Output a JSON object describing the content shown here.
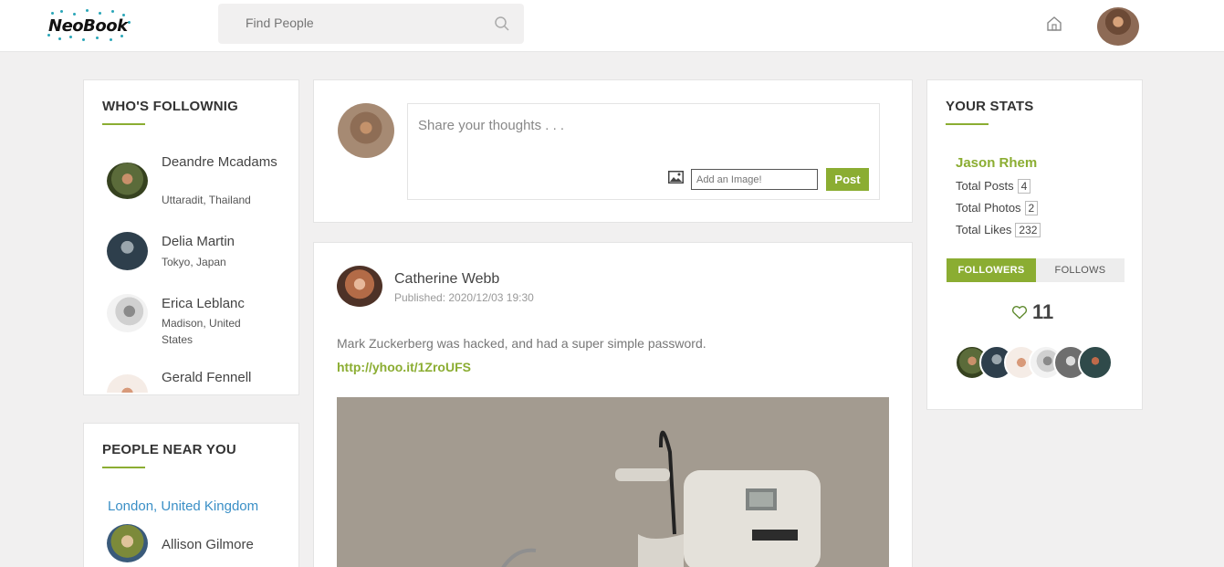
{
  "header": {
    "logo_text": "NeoBook",
    "search_placeholder": "Find People",
    "search_icon": "search-icon",
    "home_icon": "home-icon"
  },
  "following": {
    "title": "WHO'S FOLLOWNIG",
    "items": [
      {
        "name": "Deandre Mcadams",
        "location": "Uttaradit, Thailand"
      },
      {
        "name": "Delia Martin",
        "location": "Tokyo, Japan"
      },
      {
        "name": "Erica Leblanc",
        "location": "Madison, United States"
      },
      {
        "name": "Gerald Fennell",
        "location": ""
      }
    ]
  },
  "near": {
    "title": "PEOPLE NEAR YOU",
    "location": "London, United Kingdom",
    "people": [
      {
        "name": "Allison Gilmore"
      }
    ]
  },
  "compose": {
    "placeholder": "Share your thoughts . . .",
    "image_placeholder": "Add an Image!",
    "post_label": "Post"
  },
  "post": {
    "author": "Catherine Webb",
    "published": "Published: 2020/12/03 19:30",
    "text": "Mark Zuckerberg was hacked, and had a super simple password.",
    "link": "http://yhoo.it/1ZroUFS"
  },
  "stats": {
    "title": "YOUR STATS",
    "name": "Jason Rhem",
    "rows": [
      {
        "label": "Total Posts",
        "value": "4"
      },
      {
        "label": "Total Photos",
        "value": "2"
      },
      {
        "label": "Total Likes",
        "value": "232"
      }
    ],
    "tabs": {
      "followers": "FOLLOWERS",
      "follows": "FOLLOWS"
    },
    "follower_count": "11"
  },
  "colors": {
    "accent": "#8bad32",
    "link_blue": "#3a8fc6"
  }
}
